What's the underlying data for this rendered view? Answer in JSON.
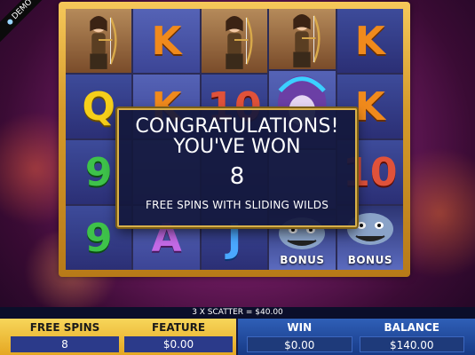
{
  "demo_badge": "DEMO",
  "reels": [
    [
      {
        "type": "archer",
        "icon": "archer-icon"
      },
      {
        "type": "letter",
        "text": "Q",
        "color": "yellow"
      },
      {
        "type": "letter",
        "text": "9",
        "color": "green"
      },
      {
        "type": "letter",
        "text": "9",
        "color": "green"
      }
    ],
    [
      {
        "type": "letter",
        "text": "K",
        "color": "orange"
      },
      {
        "type": "letter",
        "text": "K",
        "color": "orange"
      },
      {
        "type": "hidden"
      },
      {
        "type": "letter",
        "text": "A",
        "color": "purple"
      }
    ],
    [
      {
        "type": "archer",
        "icon": "archer-icon"
      },
      {
        "type": "letter",
        "text": "10",
        "color": "red"
      },
      {
        "type": "hidden"
      },
      {
        "type": "letter",
        "text": "J",
        "color": "blue"
      }
    ],
    [
      {
        "type": "archer",
        "icon": "archer-icon"
      },
      {
        "type": "warrior",
        "icon": "warrior-icon"
      },
      {
        "type": "hidden"
      },
      {
        "type": "bonus",
        "text": "BONUS",
        "icon": "monster-icon"
      }
    ],
    [
      {
        "type": "letter",
        "text": "K",
        "color": "orange"
      },
      {
        "type": "letter",
        "text": "K",
        "color": "orange"
      },
      {
        "type": "letter",
        "text": "10",
        "color": "red"
      },
      {
        "type": "bonus",
        "text": "BONUS",
        "icon": "monster-icon"
      }
    ]
  ],
  "popup": {
    "line1": "CONGRATULATIONS!",
    "line2": "YOU'VE WON",
    "count": "8",
    "feature": "FREE SPINS WITH SLIDING WILDS"
  },
  "scatter_info": "3 X SCATTER = $40.00",
  "stats": {
    "free_spins_label": "FREE SPINS",
    "free_spins_value": "8",
    "feature_label": "FEATURE",
    "feature_value": "$0.00",
    "win_label": "WIN",
    "win_value": "$0.00",
    "balance_label": "BALANCE",
    "balance_value": "$140.00"
  },
  "colors": {
    "orange": "#f08a1c",
    "red": "#e0523a",
    "green": "#3ec24a",
    "purple": "#c46ae6",
    "blue": "#4aa8ff",
    "yellow": "#f6cf1a",
    "gold_frame": "#d49a2a"
  }
}
